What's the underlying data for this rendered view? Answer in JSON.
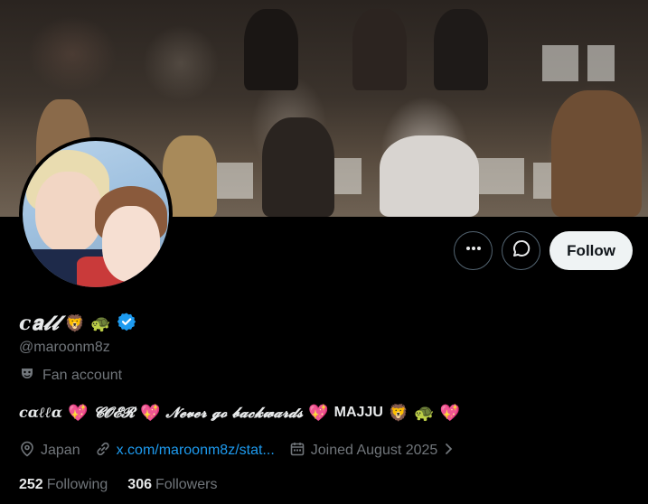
{
  "header": {
    "more_icon": "ellipsis-icon",
    "message_icon": "message-icon",
    "follow_label": "Follow"
  },
  "profile": {
    "display_name": "c𝐚𝓵𝓵",
    "name_emojis": [
      "🦁",
      "🐢"
    ],
    "verified": true,
    "handle": "@maroonm8z",
    "category_label": "Fan account",
    "bio": {
      "part1": "cαℓℓα",
      "part2": "𝓒𝓞𝓔𝓡",
      "part3": "𝓝𝓮𝓿𝓮𝓻 𝓰𝓸 𝓫𝓪𝓬𝓴𝔀𝓪𝓻𝓭𝓼",
      "part4": "MAJJU",
      "hearts": [
        "💖",
        "💖",
        "💖",
        "💖"
      ],
      "emojis": [
        "🦁",
        "🐢"
      ]
    },
    "location": "Japan",
    "link": "x.com/maroonm8z/stat...",
    "joined": "Joined August 2025",
    "following_count": "252",
    "following_label": "Following",
    "followers_count": "306",
    "followers_label": "Followers"
  },
  "colors": {
    "accent": "#1d9bf0",
    "muted": "#71767b",
    "text": "#e7e9ea",
    "background": "#000000"
  }
}
